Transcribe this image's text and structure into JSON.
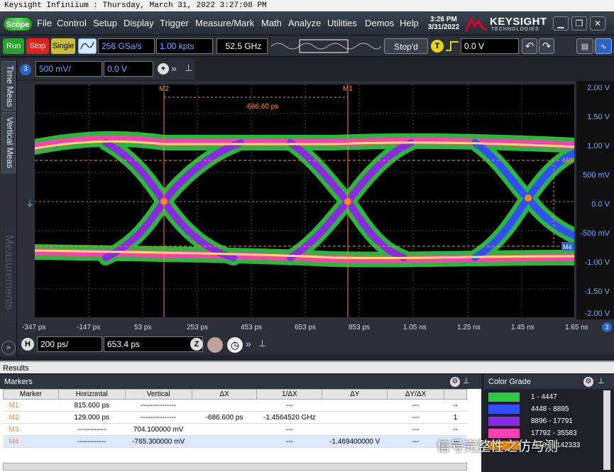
{
  "window": {
    "title": "Keysight Infiniium : Thursday, March 31, 2022 3:27:08 PM"
  },
  "menubar": {
    "scope_label": "Scope",
    "items": [
      "File",
      "Control",
      "Setup",
      "Display",
      "Trigger",
      "Measure/Mark",
      "Math",
      "Analyze",
      "Utilities",
      "Demos",
      "Help"
    ],
    "time": "3:26 PM",
    "date": "3/31/2022",
    "brand": "KEYSIGHT",
    "brand_sub": "TECHNOLOGIES"
  },
  "toolbar": {
    "run": "Run",
    "stop": "Stop",
    "single": "Single",
    "sample_rate": "256 GSa/s",
    "memory_depth": "1.00 kpts",
    "bandwidth": "52.5 GHz",
    "acq_status": "Stop'd",
    "trigger_badge": "T",
    "trigger_level": "0.0 V"
  },
  "channel": {
    "number": "3",
    "scale": "500 mV/",
    "offset": "0.0 V"
  },
  "sidebar": {
    "tabs": [
      "Time Meas",
      "Vertical Meas",
      "Measurements"
    ]
  },
  "plot": {
    "y_ticks": [
      "2.00 V",
      "1.50 V",
      "1.00 V",
      "500 mV",
      "0.0 V",
      "-500 mV",
      "-1.00 V",
      "-1.50 V",
      "-2.00 V"
    ],
    "x_ticks": [
      "-347 ps",
      "-147 ps",
      "53 ps",
      "253 ps",
      "453 ps",
      "653 ps",
      "853 ps",
      "1.05 ns",
      "1.25 ns",
      "1.45 ns",
      "1.65 ns"
    ],
    "marker_m2": "M2",
    "marker_m1": "M1",
    "marker_m3": "M3",
    "marker_m4": "M4",
    "delta_readout": "-686.60 ps"
  },
  "timebase": {
    "scale": "200 ps/",
    "position": "653.4 ps"
  },
  "results": {
    "title": "Results",
    "markers_title": "Markers",
    "columns": [
      "Marker",
      "Horizontal",
      "Vertical",
      "ΔX",
      "1/ΔX",
      "ΔY",
      "ΔY/ΔX",
      ""
    ],
    "rows": [
      [
        "M1",
        "815.600 ps",
        "---------------",
        "",
        "---",
        "",
        "---",
        "--"
      ],
      [
        "M2",
        "129.000 ps",
        "---------------",
        "-686.600 ps",
        "-1.4564520 GHz",
        "",
        "---",
        "1"
      ],
      [
        "M3",
        "------------",
        "704.100000 mV",
        "",
        "---",
        "",
        "---",
        "--"
      ],
      [
        "M4",
        "------------",
        "-765.300000 mV",
        "",
        "---",
        "-1.469400000 V",
        "---",
        "--"
      ]
    ],
    "selected_row": 3
  },
  "color_grade": {
    "title": "Color Grade",
    "ranges": [
      {
        "label": "1 - 4447",
        "color": "#2ecc40"
      },
      {
        "label": "4448 - 8895",
        "color": "#3050ff"
      },
      {
        "label": "8896 - 17791",
        "color": "#8a2be2"
      },
      {
        "label": "17792 - 35583",
        "color": "#ff3fb4"
      },
      {
        "label": "71167 - 142333",
        "color": "#ff8a00"
      }
    ]
  },
  "watermark": "信号完整性之仿与测",
  "colors": {
    "marker": "#ff8a2a",
    "axis_blue": "#6fa8ff"
  }
}
